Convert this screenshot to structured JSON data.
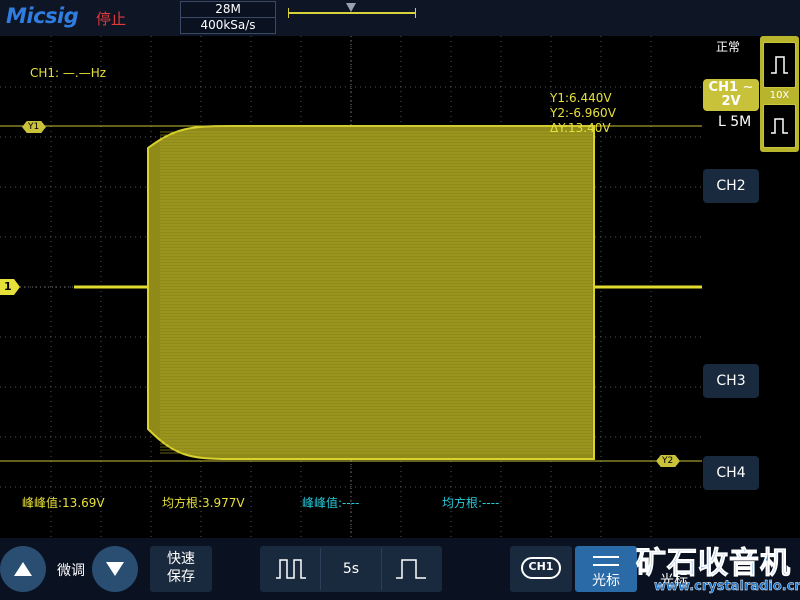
{
  "header": {
    "logo": "Micsig",
    "run_state": "停止",
    "memory_depth": "28M",
    "sample_rate": "400kSa/s"
  },
  "screen": {
    "frequency_readout": "CH1: —.—Hz",
    "cursor_readout": {
      "y1": "Y1:6.440V",
      "y2": "Y2:-6.960V",
      "dy": "ΔY:13.40V"
    },
    "cursor_tag_y1": "Y1",
    "cursor_tag_y2": "Y2",
    "channel_marker": "1",
    "measurements": [
      {
        "label": "峰峰值:13.69V",
        "color": "#e7e03a"
      },
      {
        "label": "均方根:3.977V",
        "color": "#e7e03a"
      },
      {
        "label": "峰峰值:----",
        "color": "#28c8d8"
      },
      {
        "label": "均方根:----",
        "color": "#28c8d8"
      }
    ]
  },
  "right_panel": {
    "trigger_mode": "正常",
    "probe": "10X",
    "ch1_label": "CH1",
    "ch1_coupling": "~",
    "ch1_scale": "2V",
    "timebase": "L 5M",
    "ch2": "CH2",
    "ch3": "CH3",
    "ch4": "CH4"
  },
  "bottom_bar": {
    "fine_adjust": "微调",
    "quick_save_line1": "快速",
    "quick_save_line2": "保存",
    "timebase_value": "5s",
    "ch1_select": "CH1",
    "cursor_label": "光标",
    "second_label": "光标"
  },
  "watermark": {
    "title": "矿石收音机",
    "url": "www.crystalradio.cn"
  },
  "colors": {
    "trace": "#d9d22c",
    "accent": "#2a6aa6",
    "cyan": "#28c8d8"
  }
}
